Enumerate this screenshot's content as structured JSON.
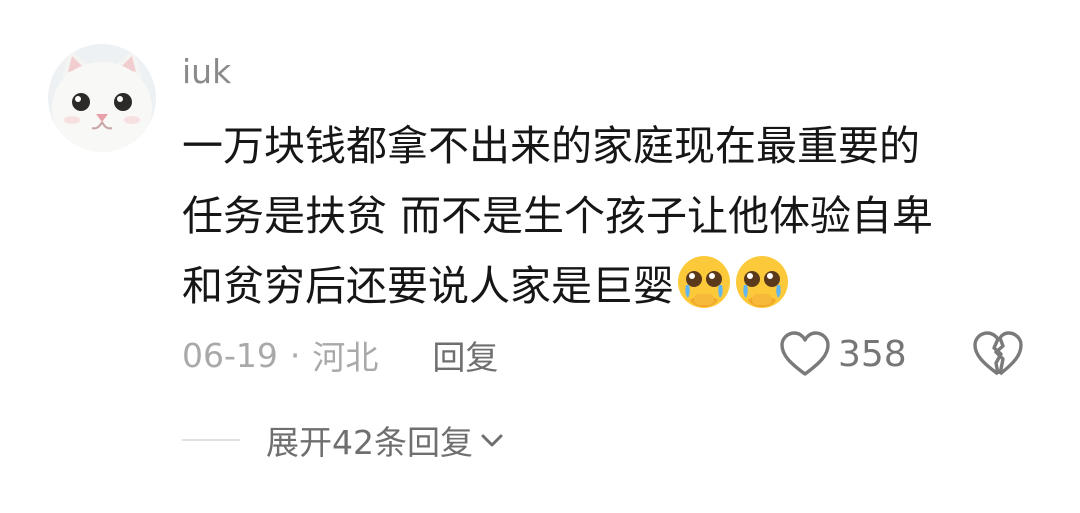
{
  "comment": {
    "username": "iuk",
    "text_lines": [
      "一万块钱都拿不出来的家庭现在最重要的",
      "任务是扶贫 而不是生个孩子让他体验自卑",
      "和贫穷后还要说人家是巨婴"
    ],
    "emojis": [
      "pleading-face-icon",
      "pleading-face-icon"
    ],
    "date": "06-19",
    "separator": "·",
    "location": "河北",
    "reply_label": "回复",
    "likes": "358"
  },
  "expand": {
    "label": "展开42条回复"
  },
  "colors": {
    "username": "#8a8a8a",
    "text": "#161616",
    "meta": "#a9a9a9",
    "action": "#6f6f6f"
  }
}
